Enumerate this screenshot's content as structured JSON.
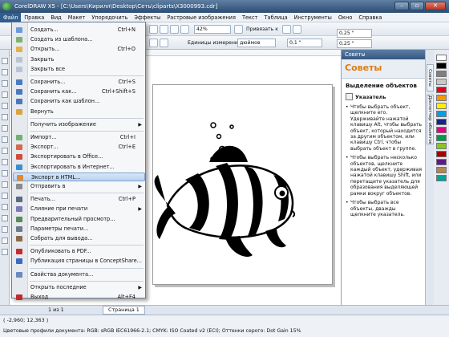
{
  "window": {
    "title": "CorelDRAW X5 - [C:\\Users\\Кирилл\\Desktop\\Сеть\\cliparts\\X3000993.cdr]"
  },
  "menubar": [
    "Файл",
    "Правка",
    "Вид",
    "Макет",
    "Упорядочить",
    "Эффекты",
    "Растровые изображения",
    "Текст",
    "Таблица",
    "Инструменты",
    "Окно",
    "Справка"
  ],
  "toolbar": {
    "zoom": "42%",
    "snap": "Привязать к",
    "units_label": "Единицы измерения:",
    "units": "дюймов",
    "nudge": "0,1 \"",
    "dup_x": "0,25 \"",
    "dup_y": "0,25 \""
  },
  "file_menu": {
    "items": [
      {
        "label": "Создать...",
        "shortcut": "Ctrl+N",
        "icon": "new-document-icon"
      },
      {
        "label": "Создать из шаблона...",
        "shortcut": "",
        "icon": "template-icon"
      },
      {
        "label": "Открыть...",
        "shortcut": "Ctrl+O",
        "icon": "open-folder-icon"
      },
      {
        "label": "Закрыть",
        "shortcut": "",
        "icon": "close-document-icon"
      },
      {
        "label": "Закрыть все",
        "shortcut": "",
        "icon": "close-all-icon"
      },
      {
        "label": "Сохранить...",
        "shortcut": "Ctrl+S",
        "icon": "save-icon"
      },
      {
        "label": "Сохранить как...",
        "shortcut": "Ctrl+Shift+S",
        "icon": "save-as-icon"
      },
      {
        "label": "Сохранить как шаблон...",
        "shortcut": "",
        "icon": "save-template-icon"
      },
      {
        "label": "Вернуть",
        "shortcut": "",
        "icon": "revert-icon"
      },
      {
        "label": "Получить изображение",
        "shortcut": "",
        "icon": "",
        "submenu": true
      },
      {
        "label": "Импорт...",
        "shortcut": "Ctrl+I",
        "icon": "import-icon"
      },
      {
        "label": "Экспорт...",
        "shortcut": "Ctrl+E",
        "icon": "export-icon"
      },
      {
        "label": "Экспортировать в Office...",
        "shortcut": "",
        "icon": "export-office-icon"
      },
      {
        "label": "Экспортировать в Интернет...",
        "shortcut": "",
        "icon": "export-web-icon"
      },
      {
        "label": "Экспорт в HTML...",
        "shortcut": "",
        "icon": "export-html-icon"
      },
      {
        "label": "Отправить в",
        "shortcut": "",
        "icon": "send-to-icon",
        "submenu": true
      },
      {
        "label": "Печать...",
        "shortcut": "Ctrl+P",
        "icon": "print-icon"
      },
      {
        "label": "Слияние при печати",
        "shortcut": "",
        "icon": "print-merge-icon",
        "submenu": true
      },
      {
        "label": "Предварительный просмотр...",
        "shortcut": "",
        "icon": "print-preview-icon"
      },
      {
        "label": "Параметры печати...",
        "shortcut": "",
        "icon": "print-setup-icon"
      },
      {
        "label": "Собрать для вывода...",
        "shortcut": "",
        "icon": "collect-output-icon"
      },
      {
        "label": "Опубликовать в PDF...",
        "shortcut": "",
        "icon": "pdf-icon"
      },
      {
        "label": "Публикация страницы в ConceptShare...",
        "shortcut": "",
        "icon": "conceptshare-icon"
      },
      {
        "label": "Свойства документа...",
        "shortcut": "",
        "icon": "properties-icon"
      },
      {
        "label": "Открыть последние",
        "shortcut": "",
        "icon": "",
        "submenu": true
      },
      {
        "label": "Выход",
        "shortcut": "Alt+F4",
        "icon": "exit-icon"
      }
    ]
  },
  "docker": {
    "header": "Советы",
    "big_title": "Советы",
    "section": "Выделение объектов",
    "tool": "Указатель",
    "tips": [
      "Чтобы выбрать объект, щелкните его. Удерживайте нажатой клавишу Alt, чтобы выбрать объект, который находится за другим объектом, или клавишу Ctrl, чтобы выбрать объект в группе.",
      "Чтобы выбрать несколько объектов, щелкните каждый объект, удерживая нажатой клавишу Shift, или перетащите указатель для образования выделяющей рамки вокруг объектов.",
      "Чтобы выбрать все объекты, дважды щелкните указатель."
    ],
    "tabs": [
      "Советы",
      "Диспетчер объектов"
    ]
  },
  "pagebar": {
    "counter": "1 из 1",
    "page": "Страница 1"
  },
  "statusbar": {
    "coords": "( -2,960; 12,363 )",
    "profile": "Цветовые профили документа: RGB: sRGB IEC61966-2.1; CMYK: ISO Coated v2 (ECI); Оттенки серого: Dot Gain 15%"
  },
  "palette": [
    "#ffffff",
    "#000000",
    "#7f7f7f",
    "#c8c8c8",
    "#e4001c",
    "#f39800",
    "#fff100",
    "#00a0e9",
    "#1d2088",
    "#e4007f",
    "#009944",
    "#8fc31f",
    "#a40000",
    "#601986",
    "#b28850",
    "#00a29a"
  ]
}
